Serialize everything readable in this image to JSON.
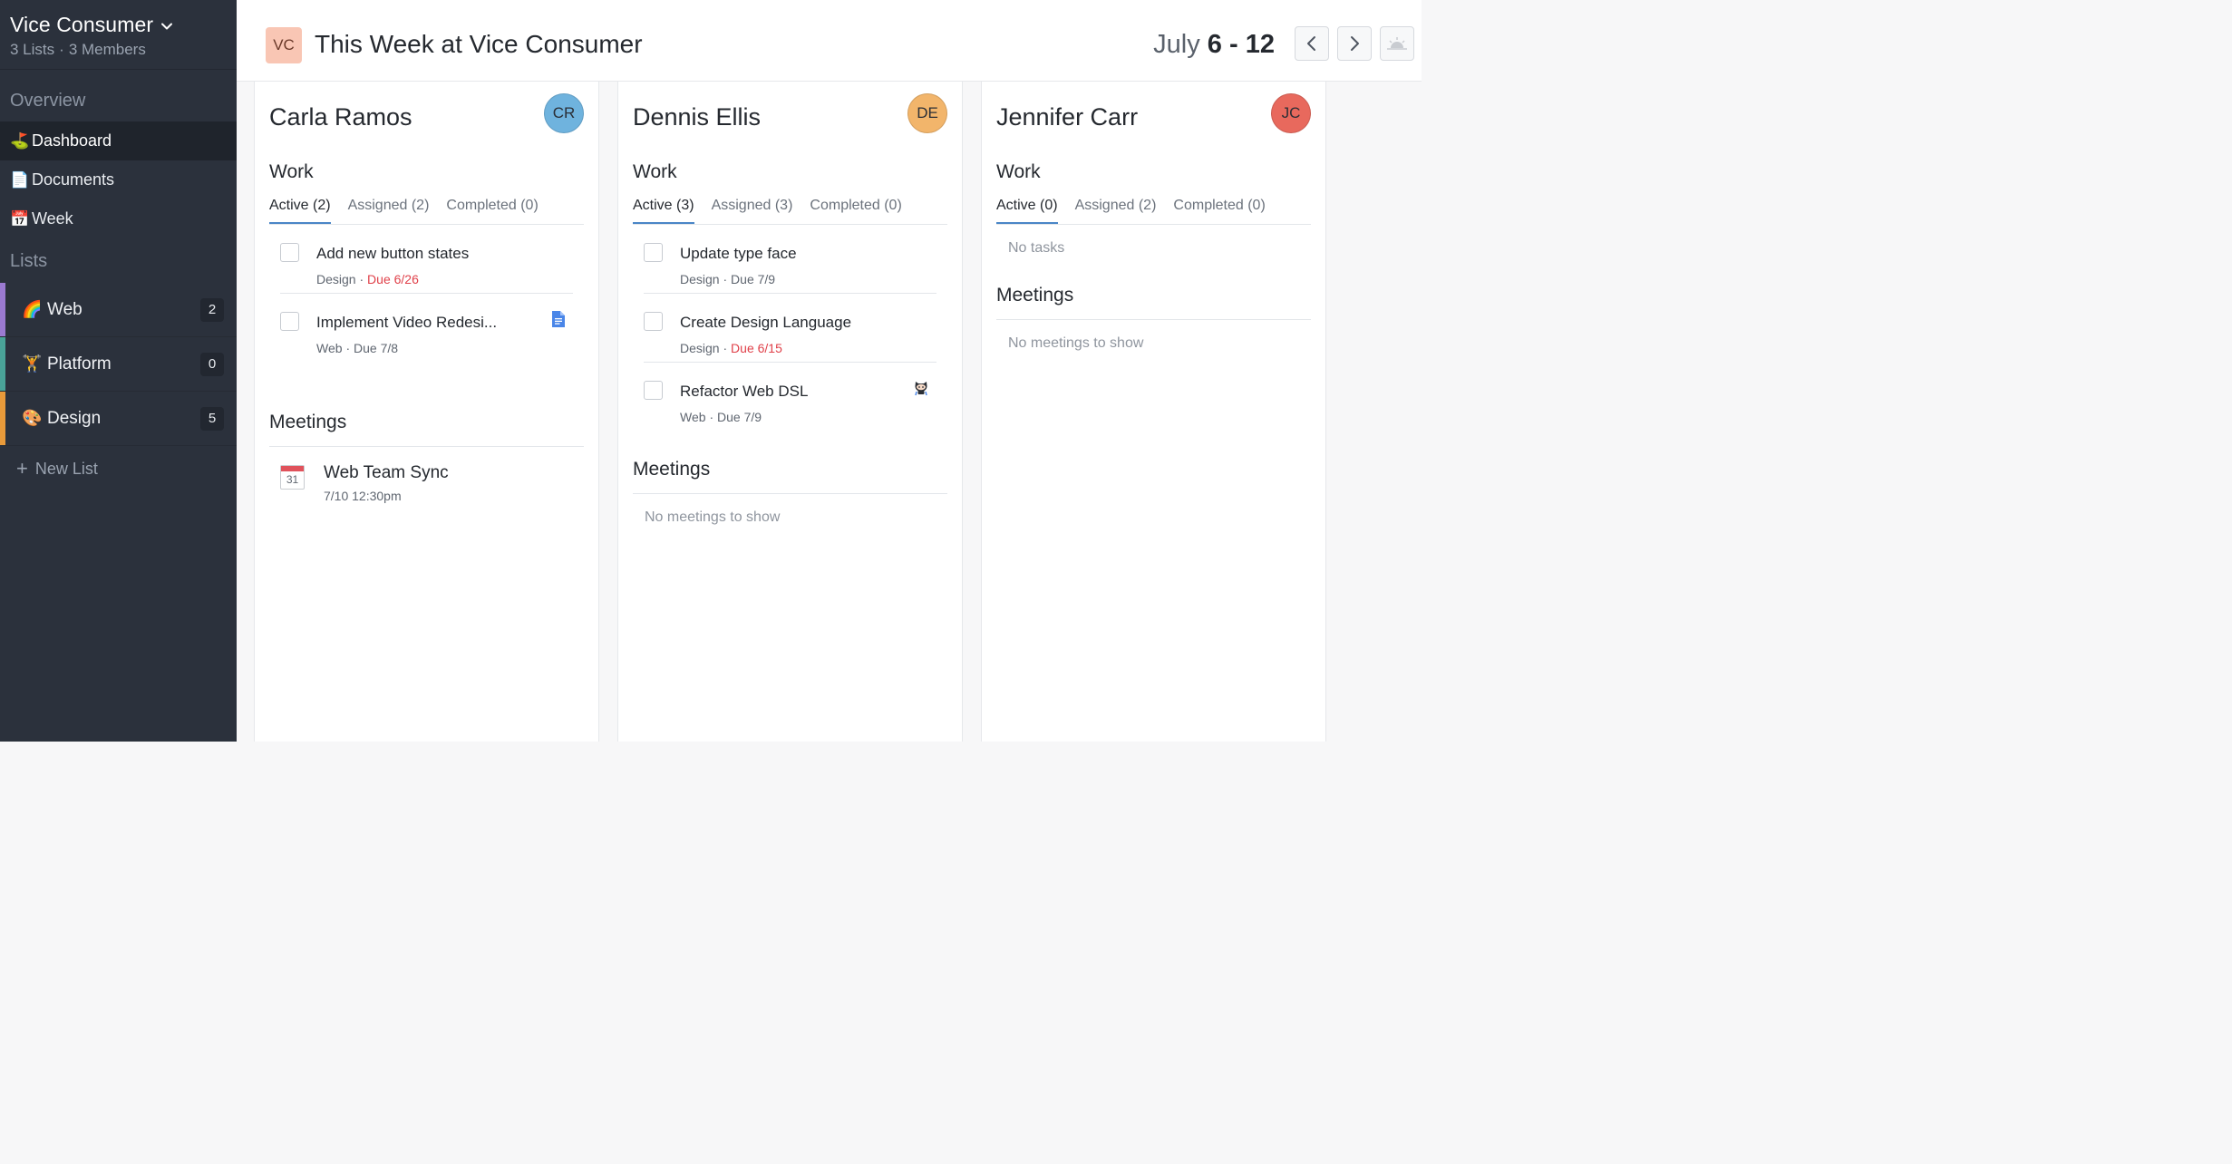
{
  "workspace": {
    "name": "Vice Consumer",
    "lists_count": "3 Lists",
    "members_count": "3 Members",
    "dot": "·"
  },
  "sidebar": {
    "overview_label": "Overview",
    "nav": [
      {
        "emoji": "⛳",
        "label": "Dashboard",
        "active": true
      },
      {
        "emoji": "📄",
        "label": "Documents"
      },
      {
        "emoji": "📅",
        "label": "Week"
      }
    ],
    "lists_label": "Lists",
    "lists": [
      {
        "emoji": "🌈",
        "label": "Web",
        "count": "2",
        "color": "#9b7ad1"
      },
      {
        "emoji": "🏋",
        "label": "Platform",
        "count": "0",
        "color": "#4aa398"
      },
      {
        "emoji": "🎨",
        "label": "Design",
        "count": "5",
        "color": "#e89a3a"
      }
    ],
    "new_list_plus": "+",
    "new_list_label": "New List"
  },
  "header": {
    "org_initials": "VC",
    "title": "This Week at Vice Consumer",
    "month": "July",
    "range_start": "6",
    "range_sep": "-",
    "range_end": "12"
  },
  "columns": [
    {
      "name": "Carla Ramos",
      "initials": "CR",
      "avatar_color": "#6fb3de",
      "work_title": "Work",
      "tabs": [
        "Active (2)",
        "Assigned (2)",
        "Completed (0)"
      ],
      "tasks": [
        {
          "title": "Add new button states",
          "list": "Design",
          "sep": "·",
          "due": "Due 6/26",
          "overdue": true
        },
        {
          "title": "Implement Video Redesi...",
          "list": "Web",
          "sep": "·",
          "due": "Due 7/8",
          "icon": "google-doc-icon"
        }
      ],
      "meetings_title": "Meetings",
      "meetings": [
        {
          "title": "Web Team Sync",
          "time": "7/10 12:30pm",
          "cal_day": "31"
        }
      ]
    },
    {
      "name": "Dennis Ellis",
      "initials": "DE",
      "avatar_color": "#f2b56b",
      "work_title": "Work",
      "tabs": [
        "Active (3)",
        "Assigned (3)",
        "Completed (0)"
      ],
      "tasks": [
        {
          "title": "Update type face",
          "list": "Design",
          "sep": "·",
          "due": "Due 7/9"
        },
        {
          "title": "Create Design Language",
          "list": "Design",
          "sep": "·",
          "due": "Due 6/15",
          "overdue": true
        },
        {
          "title": "Refactor Web DSL",
          "list": "Web",
          "sep": "·",
          "due": "Due 7/9",
          "icon": "github-octocat-icon"
        }
      ],
      "meetings_title": "Meetings",
      "no_meetings": "No meetings to show"
    },
    {
      "name": "Jennifer Carr",
      "initials": "JC",
      "avatar_color": "#e8695d",
      "work_title": "Work",
      "tabs": [
        "Active (0)",
        "Assigned (2)",
        "Completed (0)"
      ],
      "no_tasks": "No tasks",
      "meetings_title": "Meetings",
      "no_meetings": "No meetings to show"
    }
  ]
}
